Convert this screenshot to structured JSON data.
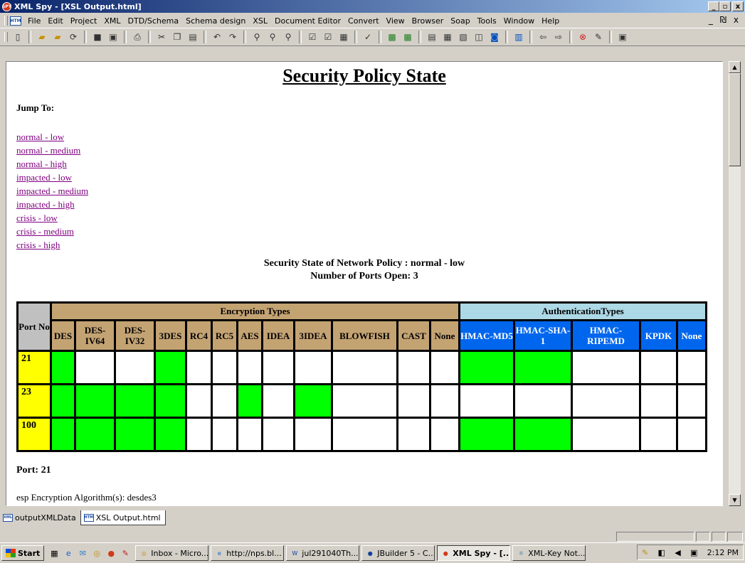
{
  "window": {
    "title": "XML Spy - [XSL Output.html]",
    "app_badge": "SPY",
    "doc_badge": "HTM"
  },
  "menu": [
    "File",
    "Edit",
    "Project",
    "XML",
    "DTD/Schema",
    "Schema design",
    "XSL",
    "Document Editor",
    "Convert",
    "View",
    "Browser",
    "Soap",
    "Tools",
    "Window",
    "Help"
  ],
  "menu_right": "_ ₪ x",
  "toolbar": [
    "new",
    "open",
    "open-url",
    "reload",
    "save",
    "save-all",
    "print",
    "cut",
    "copy",
    "paste",
    "undo",
    "redo",
    "find",
    "find-next",
    "replace",
    "check-well-formed",
    "validate",
    "spell",
    "xsl-transform",
    "fo-transform",
    "text-view",
    "grid-view",
    "schema-view",
    "auth-view",
    "browser-view",
    "table",
    "back",
    "forward",
    "stop",
    "refresh",
    "toggle"
  ],
  "page": {
    "title": "Security Policy State",
    "jump_label": "Jump To:",
    "links": [
      "normal - low",
      "normal - medium",
      "normal - high",
      "impacted - low",
      "impacted - medium",
      "impacted - high",
      "crisis - low",
      "crisis - medium",
      "crisis - high"
    ],
    "state_line": "Security State of Network Policy : normal - low",
    "ports_open": "Number of Ports Open: 3",
    "table": {
      "port_header": "Port No",
      "enc_group": "Encryption Types",
      "auth_group": "AuthenticationTypes",
      "enc_cols": [
        "DES",
        "DES-IV64",
        "DES-IV32",
        "3DES",
        "RC4",
        "RC5",
        "AES",
        "IDEA",
        "3IDEA",
        "BLOWFISH",
        "CAST",
        "None"
      ],
      "auth_cols": [
        "HMAC-MD5",
        "HMAC-SHA-1",
        "HMAC-RIPEMD",
        "KPDK",
        "None"
      ],
      "rows": [
        {
          "port": "21",
          "enc": [
            1,
            0,
            0,
            1,
            0,
            0,
            0,
            0,
            0,
            0,
            0,
            0
          ],
          "auth": [
            1,
            1,
            0,
            0,
            0
          ]
        },
        {
          "port": "23",
          "enc": [
            1,
            1,
            1,
            1,
            0,
            0,
            1,
            0,
            1,
            0,
            0,
            0
          ],
          "auth": [
            0,
            0,
            0,
            0,
            0
          ]
        },
        {
          "port": "100",
          "enc": [
            1,
            1,
            1,
            1,
            0,
            0,
            0,
            0,
            0,
            0,
            0,
            0
          ],
          "auth": [
            1,
            1,
            0,
            0,
            0
          ]
        }
      ]
    },
    "port_label": "Port: 21",
    "esp_line": "esp Encryption Algorithm(s): desdes3"
  },
  "tabs": [
    {
      "label": "outputXMLData",
      "badge": "XML",
      "active": false
    },
    {
      "label": "XSL Output.html",
      "badge": "HTM",
      "active": true
    }
  ],
  "taskbar": {
    "start": "Start",
    "tasks": [
      {
        "label": "Inbox - Micro...",
        "active": false
      },
      {
        "label": "http://nps.bl...",
        "active": false
      },
      {
        "label": "jul291040Th...",
        "active": false
      },
      {
        "label": "JBuilder 5 - C...",
        "active": false
      },
      {
        "label": "XML Spy - [...",
        "active": true
      },
      {
        "label": "XML-Key Not...",
        "active": false
      }
    ],
    "clock": "2:12 PM"
  },
  "colors": {
    "titlebar": "#0a246a",
    "link": "#800080",
    "enc_header": "#c4a373",
    "auth_header": "#0066ee",
    "enabled": "#00ff00",
    "port_cell": "#ffff00"
  }
}
